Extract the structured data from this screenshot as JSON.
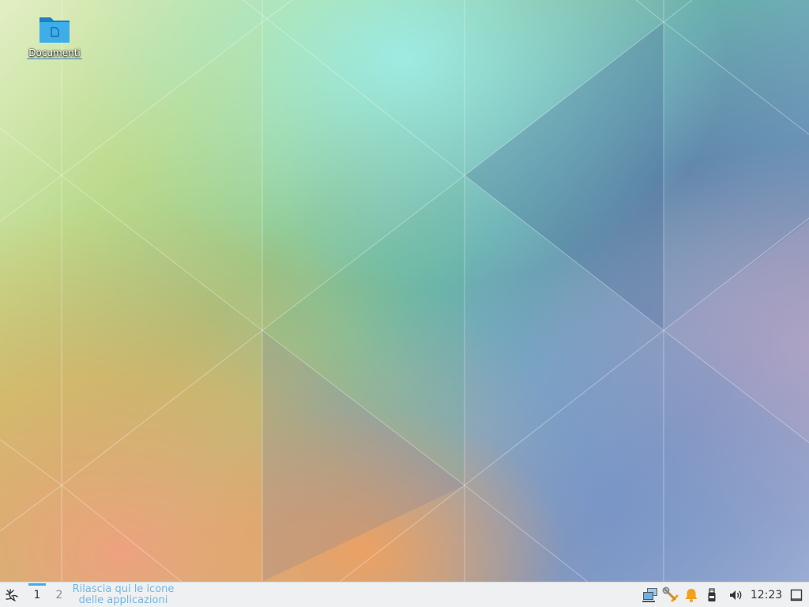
{
  "desktop": {
    "icons": [
      {
        "label": "Documenti",
        "icon": "folder-icon"
      }
    ]
  },
  "panel": {
    "launcher_icon": "kde-launcher-icon",
    "pager": {
      "desktops": [
        "1",
        "2"
      ],
      "active": "1"
    },
    "taskbar_hint": {
      "line1": "Rilascia qui le icone",
      "line2": "delle applicazioni"
    },
    "tray": {
      "icons": [
        "network-icon",
        "tools-icon",
        "notification-bell-icon",
        "usb-device-icon",
        "volume-icon"
      ]
    },
    "clock": "12:23",
    "show_desktop_icon": "show-desktop-icon"
  },
  "colors": {
    "panel_bg": "#eff0f1",
    "accent": "#3daee9",
    "hint_text": "#6fb8e6",
    "bell": "#f3a01c"
  }
}
